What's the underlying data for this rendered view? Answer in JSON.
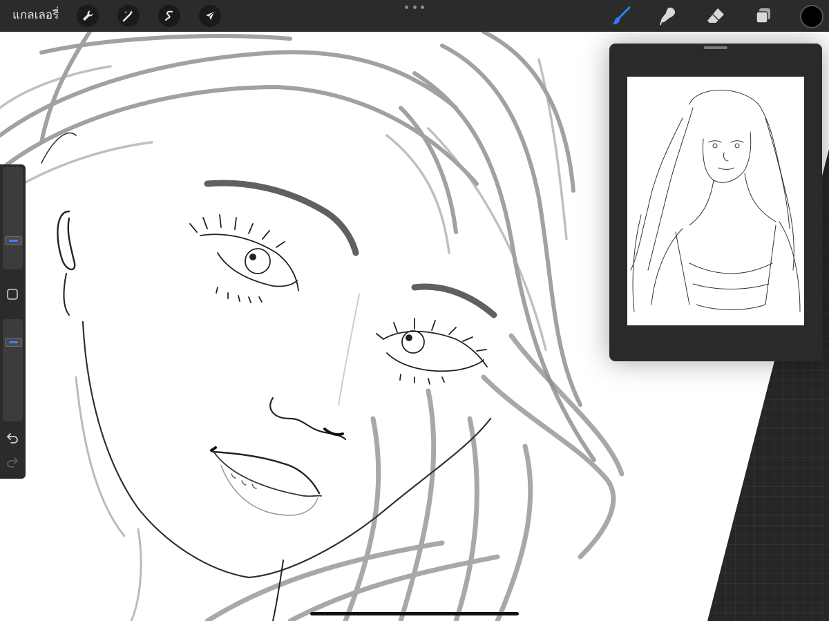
{
  "toolbar": {
    "gallery_label": "แกลเลอรี่",
    "left_tools": [
      {
        "icon": "wrench-icon",
        "name": "actions"
      },
      {
        "icon": "magic-wand-icon",
        "name": "adjustments"
      },
      {
        "icon": "selection-s-icon",
        "name": "selection"
      },
      {
        "icon": "arrow-cursor-icon",
        "name": "transform"
      }
    ],
    "right_tools": [
      {
        "icon": "brush-icon",
        "name": "paint",
        "active": true
      },
      {
        "icon": "smudge-icon",
        "name": "smudge",
        "active": false
      },
      {
        "icon": "eraser-icon",
        "name": "eraser",
        "active": false
      },
      {
        "icon": "layers-icon",
        "name": "layers",
        "active": false
      }
    ],
    "current_color": "#000000",
    "more_icon": "ellipsis-icon"
  },
  "sidebar": {
    "brush_size": 0.3,
    "opacity": 0.78,
    "modify_icon": "square-icon",
    "undo_icon": "undo-icon",
    "redo_icon": "redo-icon"
  },
  "reference": {
    "grabber_icon": "grab-handle-icon"
  },
  "colors": {
    "toolbar_bg": "#2b2b2b",
    "accent": "#3b82f6",
    "canvas": "#ffffff"
  }
}
